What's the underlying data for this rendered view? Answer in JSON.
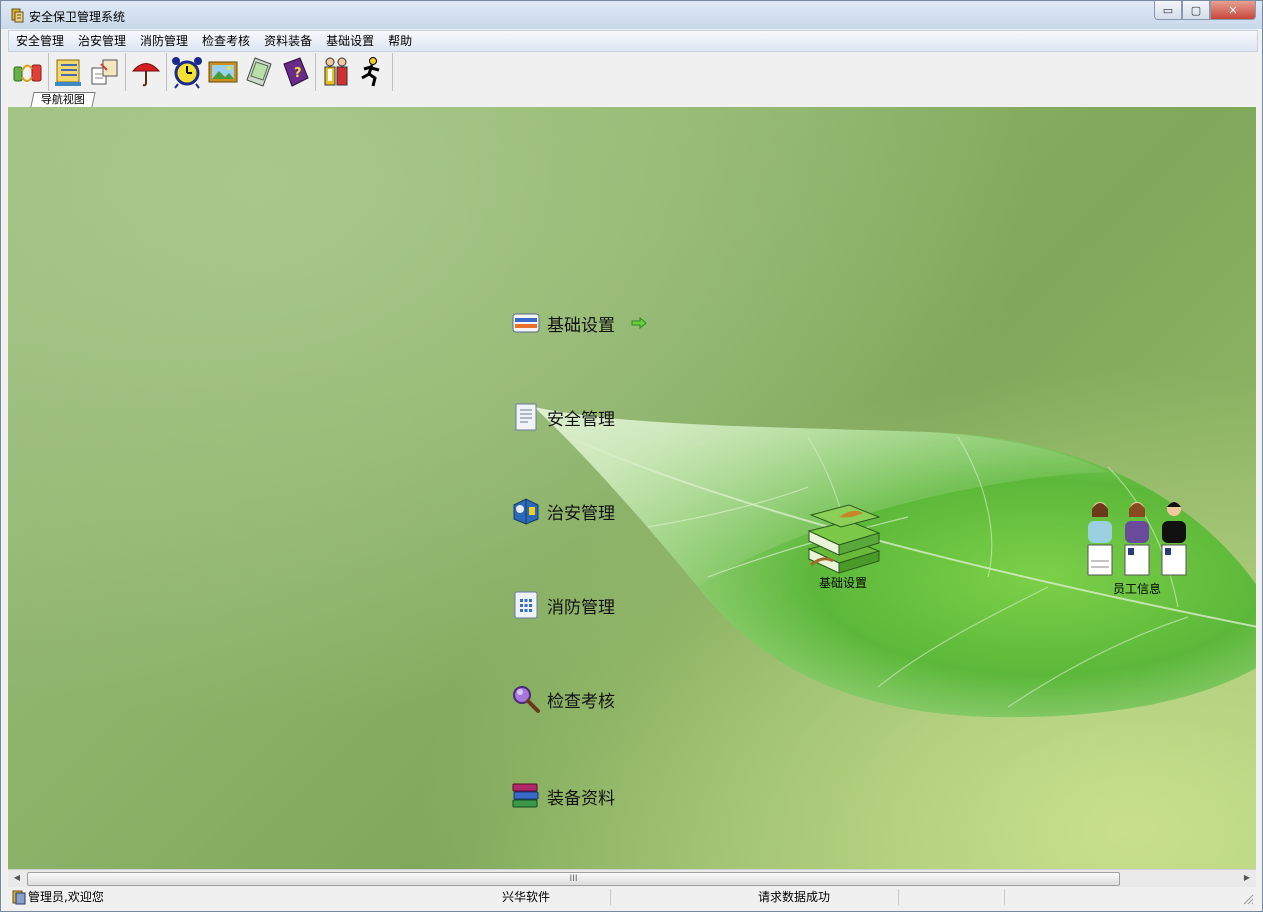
{
  "window": {
    "title": "安全保卫管理系统",
    "min_glyph": "▭",
    "max_glyph": "▢",
    "close_glyph": "✕"
  },
  "menubar": [
    "安全管理",
    "治安管理",
    "消防管理",
    "检查考核",
    "资料装备",
    "基础设置",
    "帮助"
  ],
  "toolbar": {
    "icons": [
      "connect-icon",
      "folder-icon",
      "documents-icon",
      "umbrella-icon",
      "alarm-clock-icon",
      "picture-icon",
      "pda-icon",
      "help-book-icon",
      "staff-icon",
      "runner-icon"
    ]
  },
  "tabs": {
    "active": "导航视图"
  },
  "nav": {
    "items": [
      {
        "label": "基础设置",
        "icon": "card-icon",
        "arrow": "arrow-right-icon"
      },
      {
        "label": "安全管理",
        "icon": "document-icon"
      },
      {
        "label": "治安管理",
        "icon": "cube-icon"
      },
      {
        "label": "消防管理",
        "icon": "keypad-icon"
      },
      {
        "label": "检查考核",
        "icon": "magnifier-icon"
      },
      {
        "label": "装备资料",
        "icon": "books-icon"
      }
    ]
  },
  "desktop": {
    "items": [
      {
        "label": "基础设置",
        "icon": "green-books-icon"
      },
      {
        "label": "员工信息",
        "icon": "employees-icon"
      }
    ]
  },
  "scrollbar": {
    "thumb_grip": "III",
    "left_arrow": "◀",
    "right_arrow": "▶"
  },
  "statusbar": {
    "user": "管理员,欢迎您",
    "company": "兴华软件",
    "message": "请求数据成功"
  },
  "colors": {
    "menu_bg": "#dde6f3",
    "main_green": "#8db36a",
    "leaf_green": "#5fb83a"
  }
}
